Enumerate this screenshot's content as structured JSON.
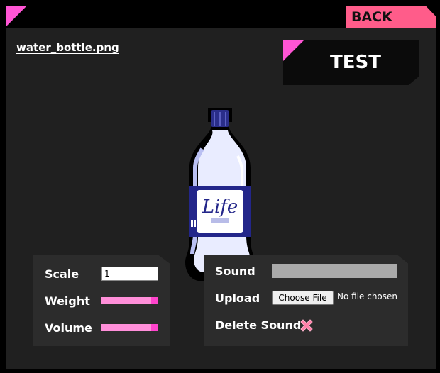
{
  "header": {
    "back_label": "BACK",
    "accent_color": "#ff55d4",
    "back_color": "#ff5c8a"
  },
  "asset": {
    "filename": "water_bottle.png",
    "bottle_brand": "Life"
  },
  "test_button": {
    "label": "TEST"
  },
  "properties": {
    "scale_label": "Scale",
    "scale_value": "1",
    "weight_label": "Weight",
    "weight_level": 0.85,
    "volume_label": "Volume",
    "volume_level": 0.85
  },
  "sound": {
    "sound_label": "Sound",
    "upload_label": "Upload",
    "choose_file_label": "Choose File",
    "no_file_text": "No file chosen",
    "delete_label": "Delete Sound",
    "delete_icon": "close-x-icon"
  }
}
